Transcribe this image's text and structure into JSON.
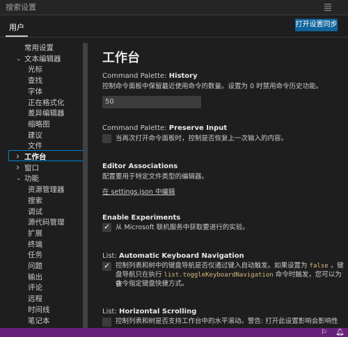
{
  "search": {
    "placeholder": "搜索设置"
  },
  "tabs": {
    "user": "用户"
  },
  "sync_button": "打开设置同步",
  "tree": [
    {
      "label": "常用设置",
      "indent": 1,
      "chev": ""
    },
    {
      "label": "文本编辑器",
      "indent": 1,
      "chev": "v"
    },
    {
      "label": "光标",
      "indent": 2,
      "chev": ""
    },
    {
      "label": "查找",
      "indent": 2,
      "chev": ""
    },
    {
      "label": "字体",
      "indent": 2,
      "chev": ""
    },
    {
      "label": "正在格式化",
      "indent": 2,
      "chev": ""
    },
    {
      "label": "差异编辑器",
      "indent": 2,
      "chev": ""
    },
    {
      "label": "缩略图",
      "indent": 2,
      "chev": ""
    },
    {
      "label": "建议",
      "indent": 2,
      "chev": ""
    },
    {
      "label": "文件",
      "indent": 2,
      "chev": ""
    },
    {
      "label": "工作台",
      "indent": 1,
      "chev": ">",
      "selected": true
    },
    {
      "label": "窗口",
      "indent": 1,
      "chev": ">"
    },
    {
      "label": "功能",
      "indent": 1,
      "chev": "v"
    },
    {
      "label": "资源管理器",
      "indent": 2,
      "chev": ""
    },
    {
      "label": "搜索",
      "indent": 2,
      "chev": ""
    },
    {
      "label": "调试",
      "indent": 2,
      "chev": ""
    },
    {
      "label": "源代码管理",
      "indent": 2,
      "chev": ""
    },
    {
      "label": "扩展",
      "indent": 2,
      "chev": ""
    },
    {
      "label": "终端",
      "indent": 2,
      "chev": ""
    },
    {
      "label": "任务",
      "indent": 2,
      "chev": ""
    },
    {
      "label": "问题",
      "indent": 2,
      "chev": ""
    },
    {
      "label": "输出",
      "indent": 2,
      "chev": ""
    },
    {
      "label": "评论",
      "indent": 2,
      "chev": ""
    },
    {
      "label": "远程",
      "indent": 2,
      "chev": ""
    },
    {
      "label": "时间线",
      "indent": 2,
      "chev": ""
    },
    {
      "label": "笔记本",
      "indent": 2,
      "chev": ""
    }
  ],
  "content": {
    "title": "工作台",
    "history": {
      "prefix": "Command Palette: ",
      "name": "History",
      "desc": "控制命令面板中保留最近使用命令的数量。设置为 0 时禁用命令历史功能。",
      "value": "50"
    },
    "preserve": {
      "prefix": "Command Palette: ",
      "name": "Preserve Input",
      "desc": "当再次打开命令面板时，控制是否恢复上一次输入的内容。",
      "checked": false
    },
    "editor_assoc": {
      "name": "Editor Associations",
      "desc": "配置要用于特定文件类型的编辑器。",
      "link": "在 settings.json 中编辑"
    },
    "experiments": {
      "name": "Enable Experiments",
      "desc": "从 Microsoft 联机服务中获取要进行的实验。",
      "checked": true
    },
    "keyboard_nav": {
      "prefix": "List: ",
      "name": "Automatic Keyboard Navigation",
      "desc1a": "控制列表和树中的键盘导航是否仅通过键入自动触发。如果设置为 ",
      "code1": "false",
      "desc1b": " ，键",
      "desc2a": "盘导航只在执行 ",
      "code2": "list.toggleKeyboardNavigation",
      "desc2b": " 命令时触发，您可以为该",
      "desc3": "命令指定键盘快捷方式。",
      "checked": true
    },
    "hscroll": {
      "prefix": "List: ",
      "name": "Horizontal Scrolling",
      "desc": "控制列表和树是否支持工作台中的水平滚动。警告: 打开此设置影响会影响性",
      "checked": false
    }
  },
  "colors": {
    "accent": "#0e639c",
    "statusbar": "#68217a",
    "selection": "#007fd4"
  }
}
